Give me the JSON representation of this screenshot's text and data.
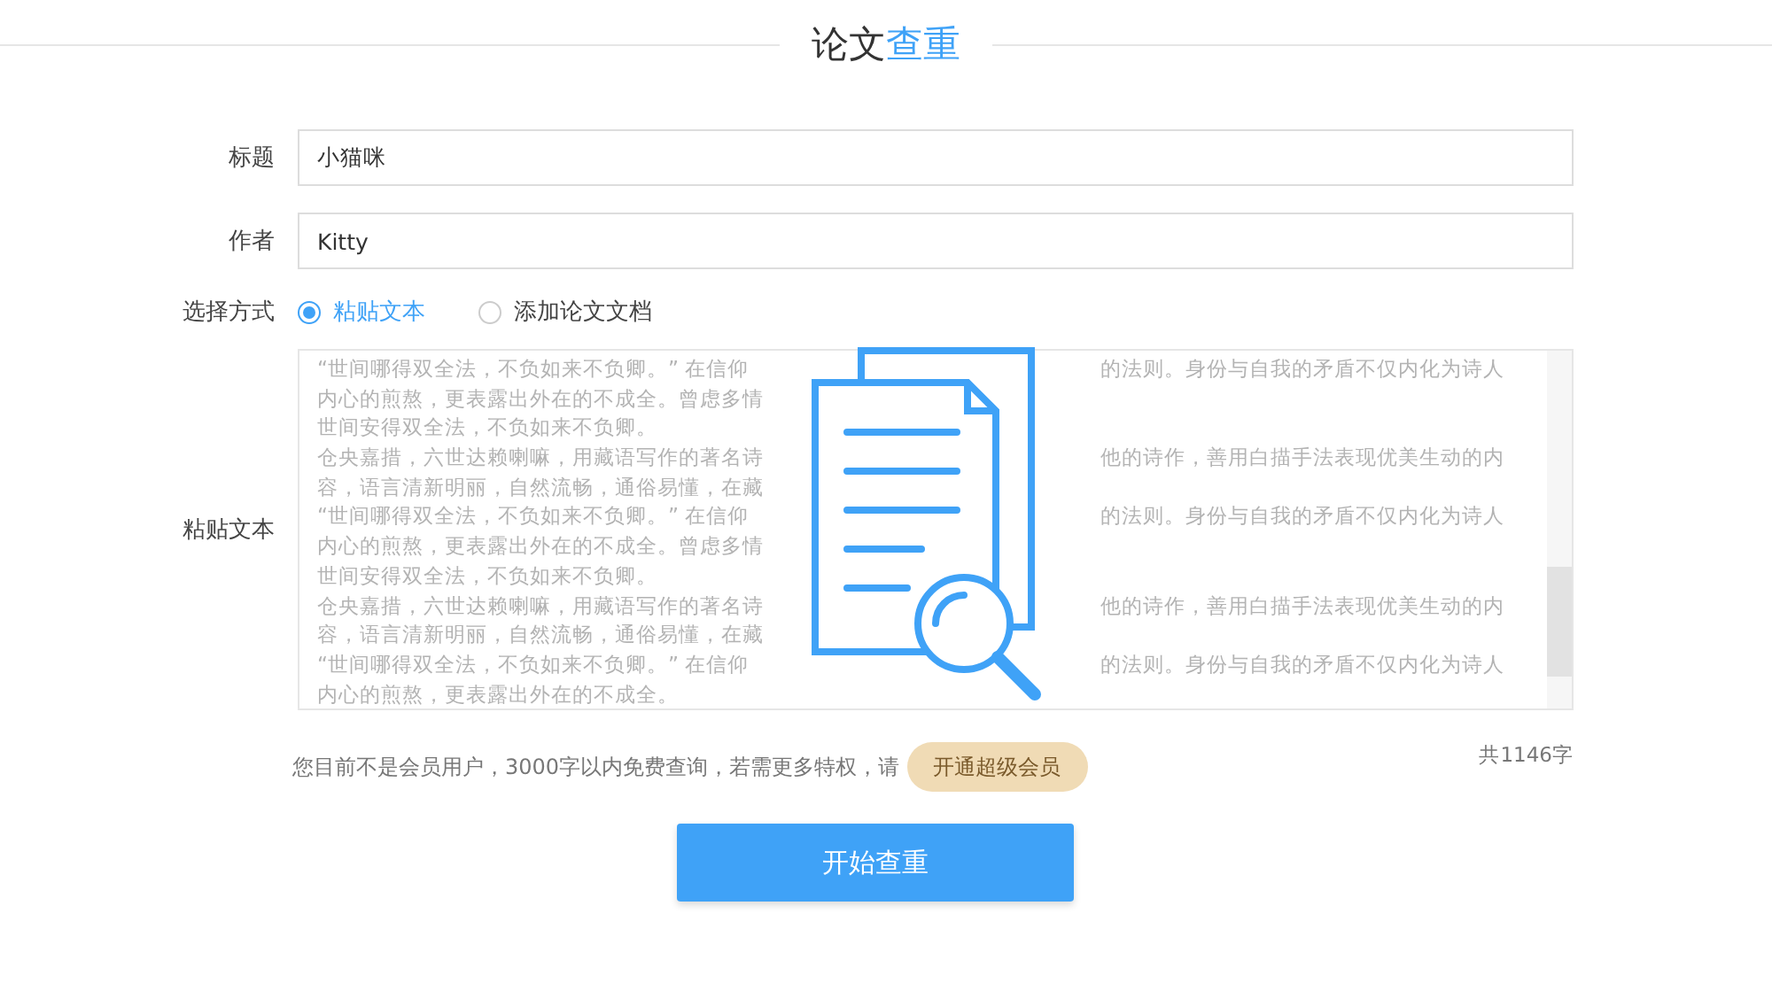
{
  "heading": [
    {
      "text": "论文",
      "highlight": false
    },
    {
      "text": "查重",
      "highlight": true
    }
  ],
  "fields": [
    {
      "label": "标题",
      "value": "小猫咪"
    },
    {
      "label": "作者",
      "value": "Kitty"
    }
  ],
  "method": {
    "label": "选择方式",
    "options": [
      {
        "label": "粘贴文本",
        "selected": true
      },
      {
        "label": "添加论文文档",
        "selected": false
      }
    ]
  },
  "paste": {
    "label": "粘贴文本",
    "lines": [
      {
        "left": "“世间哪得双全法，不负如来不负卿。” 在信仰",
        "right": "的法则。身份与自我的矛盾不仅内化为诗人"
      },
      {
        "left": "内心的煎熬，更表露出外在的不成全。曾虑多情"
      },
      {
        "left": "世间安得双全法，不负如来不负卿。"
      },
      {
        "left": "仓央嘉措，六世达赖喇嘛，用藏语写作的著名诗",
        "right": "他的诗作，善用白描手法表现优美生动的内"
      },
      {
        "left": "容，语言清新明丽，自然流畅，通俗易懂，在藏"
      },
      {
        "left": "“世间哪得双全法，不负如来不负卿。” 在信仰",
        "right": "的法则。身份与自我的矛盾不仅内化为诗人"
      },
      {
        "left": "内心的煎熬，更表露出外在的不成全。曾虑多情"
      },
      {
        "left": "世间安得双全法，不负如来不负卿。"
      },
      {
        "left": "仓央嘉措，六世达赖喇嘛，用藏语写作的著名诗",
        "right": "他的诗作，善用白描手法表现优美生动的内"
      },
      {
        "left": "容，语言清新明丽，自然流畅，通俗易懂，在藏"
      },
      {
        "left": "“世间哪得双全法，不负如来不负卿。” 在信仰",
        "right": "的法则。身份与自我的矛盾不仅内化为诗人"
      },
      {
        "left": "内心的煎熬，更表露出外在的不成全。"
      }
    ]
  },
  "notice": "您目前不是会员用户，3000字以内免费查询，若需更多特权，请",
  "upgrade_button": "开通超级会员",
  "char_count": "共1146字",
  "submit_button": "开始查重"
}
